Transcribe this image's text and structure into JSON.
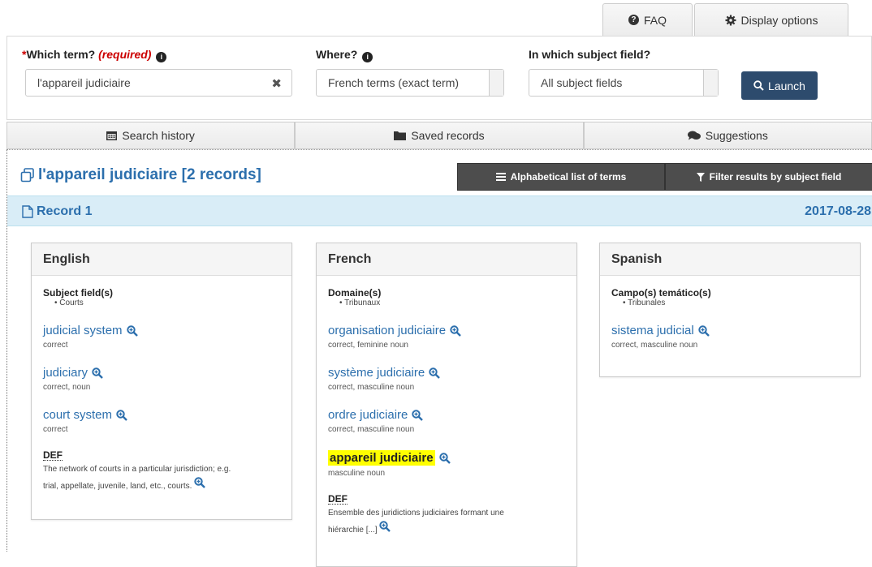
{
  "header": {
    "faq_label": "FAQ",
    "display_label": "Display options"
  },
  "search": {
    "term_label": "Which term?",
    "required_text": "(required)",
    "term_value": "l'appareil judiciaire",
    "where_label": "Where?",
    "where_value": "French terms (exact term)",
    "subject_label": "In which subject field?",
    "subject_value": "All subject fields",
    "launch_label": "Launch"
  },
  "tabs": [
    {
      "label": "Search history"
    },
    {
      "label": "Saved records"
    },
    {
      "label": "Suggestions"
    }
  ],
  "results": {
    "title": "l'appareil judiciaire [2 records]",
    "alpha_label": "Alphabetical list of terms",
    "filter_label": "Filter results by subject field"
  },
  "record": {
    "label": "Record 1",
    "date": "2017-08-28"
  },
  "english": {
    "heading": "English",
    "subject_label": "Subject field(s)",
    "subject_item": "Courts",
    "terms": [
      {
        "term": "judicial system",
        "grammar": "correct"
      },
      {
        "term": "judiciary",
        "grammar": "correct, noun"
      },
      {
        "term": "court system",
        "grammar": "correct"
      }
    ],
    "def_label": "DEF",
    "def_line1": "The network of courts in a particular jurisdiction; e.g.",
    "def_line2": "trial, appellate, juvenile, land, etc., courts."
  },
  "french": {
    "heading": "French",
    "subject_label": "Domaine(s)",
    "subject_item": "Tribunaux",
    "terms": [
      {
        "term": "organisation judiciaire",
        "grammar": "correct, feminine noun"
      },
      {
        "term": "système judiciaire",
        "grammar": "correct, masculine noun"
      },
      {
        "term": "ordre judiciaire",
        "grammar": "correct, masculine noun"
      },
      {
        "term": "appareil judiciaire",
        "grammar": "masculine noun"
      }
    ],
    "def_label": "DEF",
    "def_line1": "Ensemble des juridictions judiciaires formant une",
    "def_line2": "hiérarchie [...]"
  },
  "spanish": {
    "heading": "Spanish",
    "subject_label": "Campo(s) temático(s)",
    "subject_item": "Tribunales",
    "terms": [
      {
        "term": "sistema judicial",
        "grammar": "correct, masculine noun"
      }
    ]
  },
  "colors": {
    "link": "#2c6fad",
    "launch_bg": "#2d4b6d",
    "record_bar": "#d9edf7",
    "highlight": "#ffff00"
  }
}
